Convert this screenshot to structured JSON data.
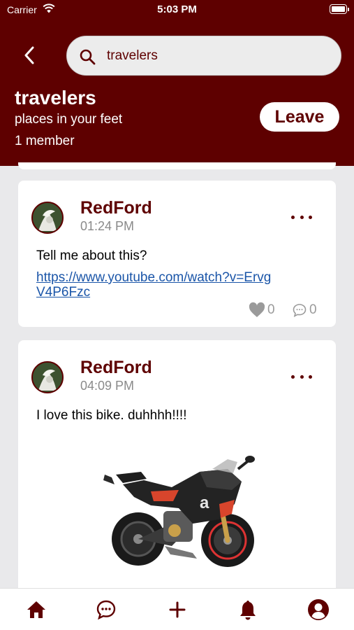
{
  "status_bar": {
    "carrier": "Carrier",
    "time": "5:03 PM"
  },
  "search": {
    "value": "travelers",
    "placeholder": "Search"
  },
  "group": {
    "title": "travelers",
    "subtitle": "places in your feet",
    "members": "1 member",
    "leave_label": "Leave"
  },
  "posts": [
    {
      "author": "RedFord",
      "time": "01:24 PM",
      "text": "Tell me about this?",
      "link": "https://www.youtube.com/watch?v=ErvgV4P6Fzc",
      "likes": "0",
      "comments": "0"
    },
    {
      "author": "RedFord",
      "time": "04:09 PM",
      "text": "I love this bike. duhhhh!!!!"
    }
  ],
  "colors": {
    "brand": "#5e0000",
    "link": "#1a55a8",
    "muted": "#9a9a9a",
    "background": "#e9e9eb"
  },
  "tabs": [
    {
      "name": "home",
      "icon": "home-icon"
    },
    {
      "name": "chat",
      "icon": "chat-icon"
    },
    {
      "name": "create",
      "icon": "plus-icon"
    },
    {
      "name": "notifications",
      "icon": "bell-icon"
    },
    {
      "name": "profile",
      "icon": "user-icon"
    }
  ]
}
